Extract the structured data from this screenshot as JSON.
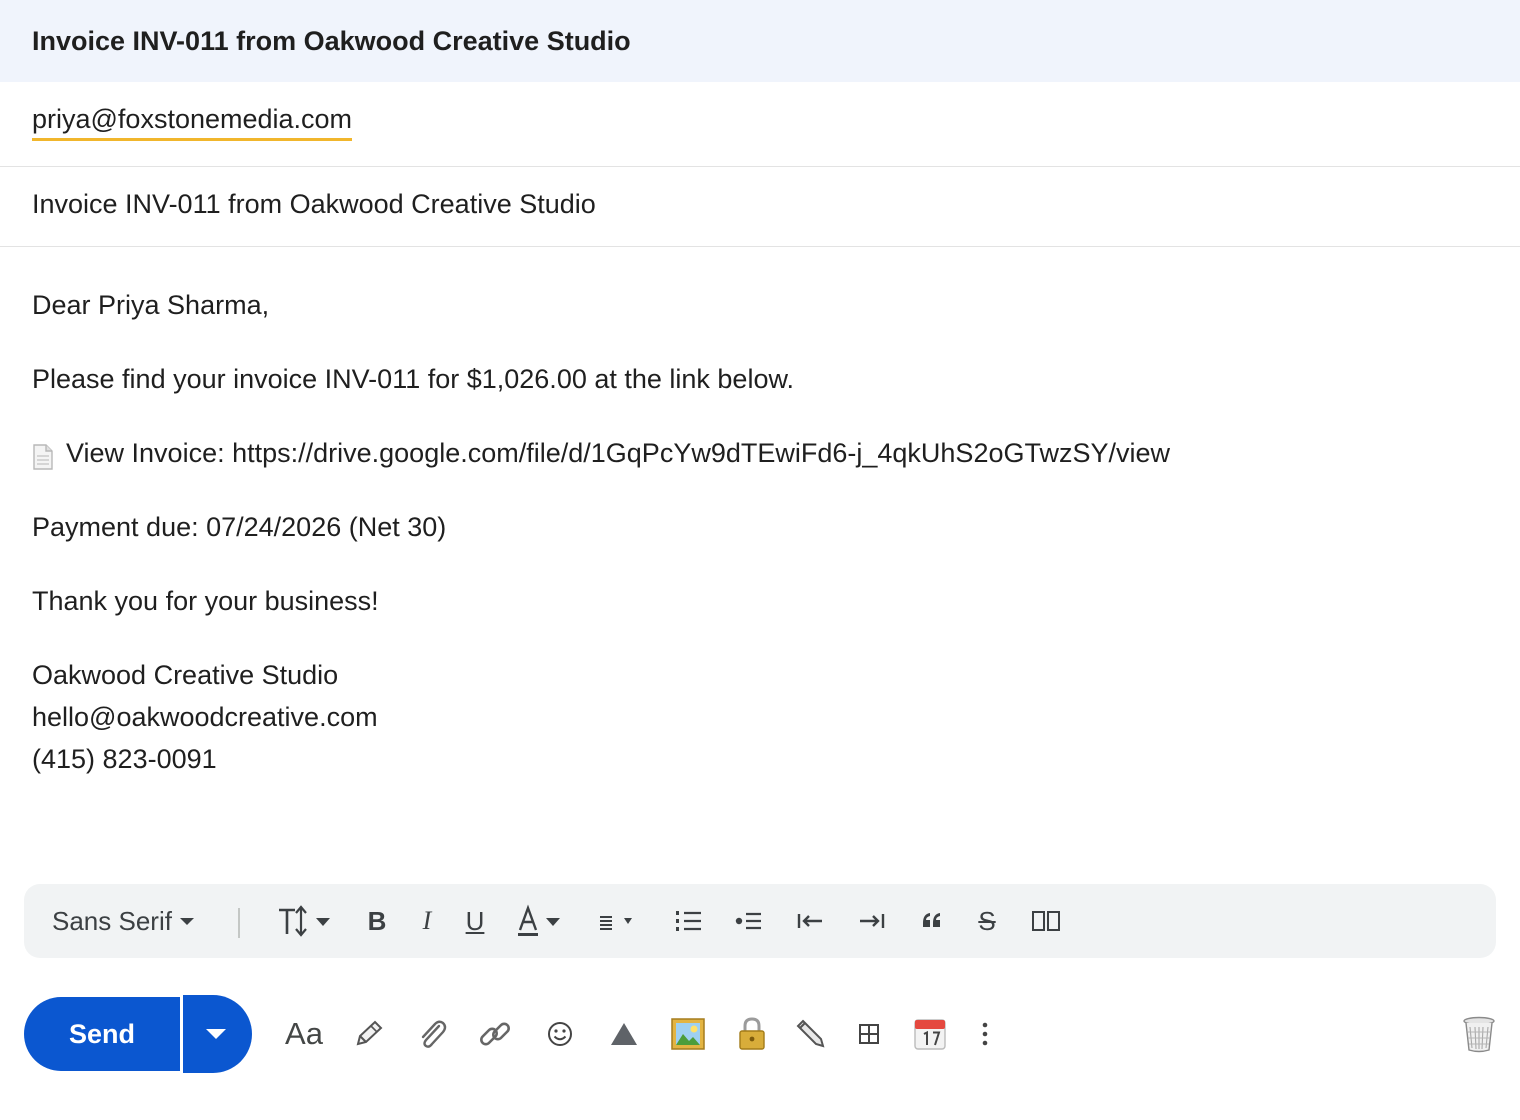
{
  "header": {
    "title": "Invoice INV-011 from Oakwood Creative Studio"
  },
  "to": {
    "recipient": "priya@foxstonemedia.com"
  },
  "subject": {
    "value": "Invoice INV-011 from Oakwood Creative Studio"
  },
  "body": {
    "greeting": "Dear Priya Sharma,",
    "line1": "Please find your invoice INV-011 for $1,026.00 at the link below.",
    "link_text": "View Invoice: https://drive.google.com/file/d/1GqPcYw9dTEwiFd6-j_4qkUhS2oGTwzSY/view",
    "due": "Payment due: 07/24/2026 (Net 30)",
    "thanks": "Thank you for your business!",
    "signature": [
      "Oakwood Creative Studio",
      "hello@oakwoodcreative.com",
      "(415) 823-0091"
    ]
  },
  "formatting": {
    "font": "Sans Serif",
    "icons": [
      "text-size-icon",
      "bold-icon",
      "italic-icon",
      "underline-icon",
      "text-color-icon",
      "align-icon",
      "numbered-list-icon",
      "bulleted-list-icon",
      "indent-less-icon",
      "indent-more-icon",
      "quote-icon",
      "strikethrough-icon",
      "remove-formatting-icon"
    ]
  },
  "bottom": {
    "send_label": "Send",
    "format_label": "Aa",
    "icons": [
      "pencil-icon",
      "attach-icon",
      "link-icon",
      "emoji-icon",
      "drive-icon",
      "photo-icon",
      "lock-icon",
      "signature-icon",
      "layout-icon",
      "calendar-icon",
      "more-options-icon",
      "trash-icon"
    ]
  },
  "colors": {
    "header_bg": "#f0f4fc",
    "send_blue": "#0b57d0",
    "spell_underline": "#f1b62c",
    "toolbar_bg": "#f1f3f4"
  }
}
